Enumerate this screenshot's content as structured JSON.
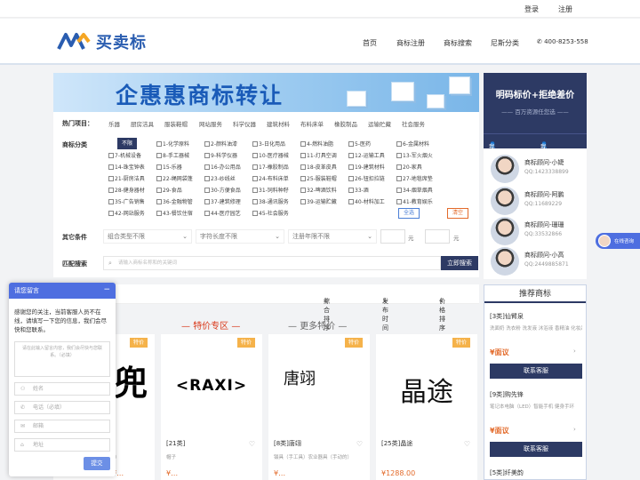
{
  "topbar": {
    "login": "登录",
    "register": "注册"
  },
  "brand": {
    "name": "买卖标",
    "accent": "#2a5db0",
    "dark": "#2d3a64",
    "orange": "#e36a2a"
  },
  "nav": {
    "home": "首页",
    "tm_register": "商标注册",
    "tm_search": "商标搜索",
    "nice": "尼斯分类",
    "phone": "400-8253-558"
  },
  "banner": {
    "title": "企惠惠商标转让"
  },
  "filter": {
    "hot_label": "热门项目：",
    "hot": [
      "乐器",
      "厨房洁具",
      "服装鞋帽",
      "网站服务",
      "科学仪器",
      "建筑材料",
      "布料床单",
      "橡胶制品",
      "运输贮藏",
      "社会服务"
    ],
    "class_label": "商标分类",
    "unlimited": "不限",
    "classes": [
      "1-化学原料",
      "2-颜料油漆",
      "3-日化用品",
      "4-燃料油脂",
      "5-医药",
      "6-金属材料",
      "7-机械设备",
      "8-手工器械",
      "9-科学仪器",
      "10-医疗器械",
      "11-灯具空调",
      "12-运输工具",
      "13-军火烟火",
      "14-珠宝钟表",
      "15-乐器",
      "16-办公用品",
      "17-橡胶制品",
      "18-皮革皮具",
      "19-建筑材料",
      "20-家具",
      "21-厨房洁具",
      "22-绳网袋蓬",
      "23-纱线丝",
      "24-布料床单",
      "25-服装鞋帽",
      "26-钮扣拉链",
      "27-地毯席垫",
      "28-健身器材",
      "29-食品",
      "30-方便食品",
      "31-饲料种籽",
      "32-啤酒饮料",
      "33-酒",
      "34-烟草烟具",
      "35-广告销售",
      "36-金融物管",
      "37-建筑修理",
      "38-通讯服务",
      "39-运输贮藏",
      "40-材料加工",
      "41-教育娱乐",
      "42-网站服务",
      "43-餐饮住宿",
      "44-医疗园艺",
      "45-社会服务"
    ],
    "select_all": "全选",
    "clear": "清空",
    "other_label": "其它条件",
    "combo": "组合类型不限",
    "length": "字符长度不限",
    "year": "注册年限不限",
    "yuan1": "元",
    "yuan2": "元",
    "match_label": "匹配搜索",
    "search_placeholder": "请输入商标名称和的关键词",
    "search_btn": "立即搜索"
  },
  "sort": {
    "composite": "综合排序",
    "time": "发布时间",
    "price": "价格排序"
  },
  "sections": {
    "special": "特价专区",
    "more": "更多特价"
  },
  "cards": [
    {
      "tag": "特价",
      "mark": "兜",
      "name": "",
      "desc": "品（手工器械）",
      "price": "¥…"
    },
    {
      "tag": "特价",
      "mark": "<RAXI>",
      "name": "[21类]",
      "desc": "帽子",
      "price": "¥…"
    },
    {
      "tag": "特价",
      "mark": "唐翊",
      "name": "[8类]唐翊",
      "desc": "镊具（手工具）农业器具（手动的）",
      "price": "¥…"
    },
    {
      "tag": "特价",
      "mark": "晶途",
      "name": "[25类]晶途",
      "desc": "",
      "price": "¥1288.00"
    }
  ],
  "right": {
    "title": "明码标价+拒绝差价",
    "sub": "—— 百万资源任您选 ——",
    "tab_sell": "我要卖商标",
    "tab_buy": "我要求购",
    "agents": [
      {
        "name": "商标顾问-小婕",
        "qq": "QQ:1423338899"
      },
      {
        "name": "商标顾问-阿鹏",
        "qq": "QQ:11689229"
      },
      {
        "name": "商标顾问-珊珊",
        "qq": "QQ:33532866"
      },
      {
        "name": "商标顾问-小高",
        "qq": "QQ:2449885871"
      }
    ]
  },
  "recommend": {
    "title": "推荐商标",
    "items": [
      {
        "name": "[3类]仙臂泉",
        "desc": "洗面奶 洗衣粉 洗发液 沐浴液 香精油 化妆品",
        "price": "¥面议",
        "btn": "联系客服"
      },
      {
        "name": "[9类]购先锋",
        "desc": "笔记本电脑（LED）智能手机 健身手环",
        "price": "¥面议",
        "btn": "联系客服"
      },
      {
        "name": "[5类]纤美韵",
        "desc": "",
        "price": "",
        "btn": ""
      }
    ]
  },
  "chat": {
    "title": "请您留言",
    "message": "感谢您的关注，当前客服人员不在线，请填写一下您的信息，我们会尽快和您联系。",
    "area_placeholder": "请在此输入留言内容，我们会尽快与您联系。（必填）",
    "name": "姓名",
    "phone": "电话（必填）",
    "email": "邮箱",
    "address": "地址",
    "submit": "提交"
  },
  "online": {
    "label": "在线咨询"
  }
}
